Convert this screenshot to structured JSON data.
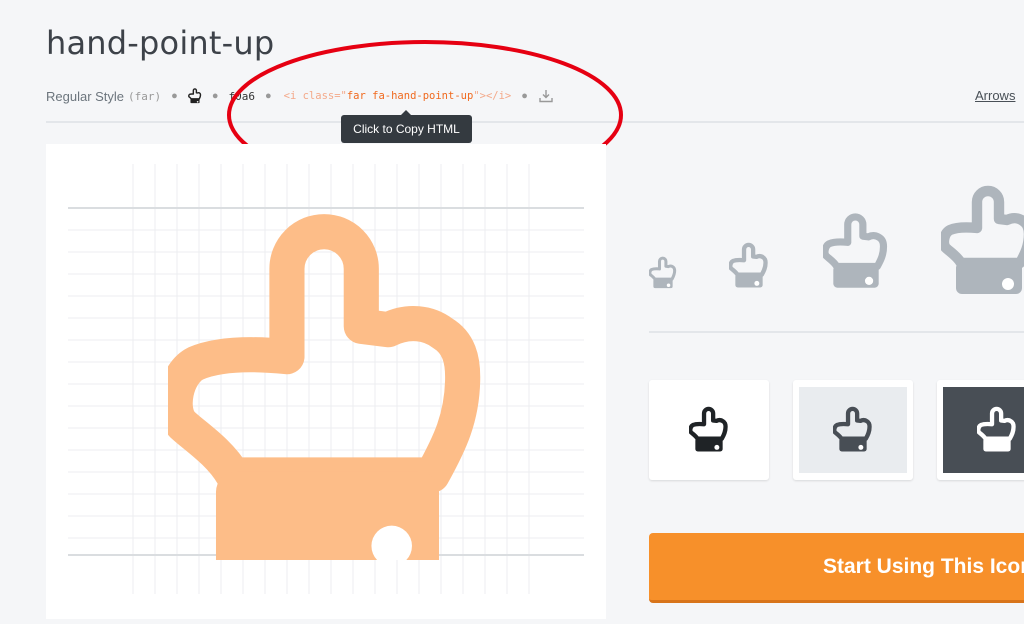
{
  "page_title": "hand-point-up",
  "meta": {
    "style_label": "Regular Style",
    "style_prefix": "(far)",
    "unicode": "f0a6",
    "snippet_open": "<i class=\"",
    "snippet_class": "far fa-hand-point-up",
    "snippet_close": "\"></i>",
    "category_link": "Arrows"
  },
  "tooltip": "Click to Copy HTML",
  "cta_label": "Start Using This Icon",
  "colors": {
    "accent": "#f7902a",
    "preview_icon": "#fdbd88",
    "size_icon": "#aeb5bc",
    "annotation": "#e60012",
    "dark_swatch": "#484e55",
    "light_swatch": "#e9ecef"
  },
  "icons": [
    "hand-point-up-icon",
    "download-icon"
  ]
}
